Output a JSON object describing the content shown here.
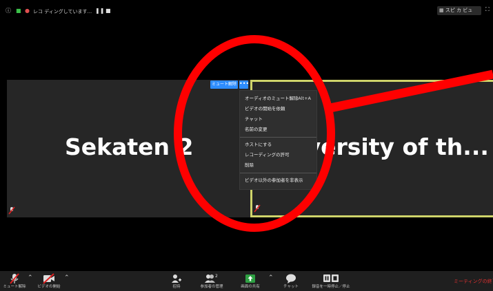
{
  "app": {
    "recording_label": "レコ ディングしています...",
    "view_label": "スピ カ ビュ"
  },
  "tiles": [
    {
      "name": "Sekaten 2"
    },
    {
      "name": "University of th..."
    }
  ],
  "hover_buttons": {
    "unmute": "ミュート解除",
    "more": "•••"
  },
  "context_menu": {
    "items": [
      {
        "label": "オーディオのミュート解除",
        "shortcut": "Alt+A"
      },
      {
        "label": "ビデオの開始を依頼"
      },
      {
        "label": "チャット"
      },
      {
        "label": "名前の変更"
      },
      {
        "label": "ホストにする"
      },
      {
        "label": "レコーディングの許可"
      },
      {
        "label": "削除"
      },
      {
        "label": "ビデオ以外の参加者を非表示"
      }
    ]
  },
  "toolbar": {
    "unmute": "ミュート解除",
    "video_start": "ビデオの開始",
    "invite": "招待",
    "participants": "参加者の管理",
    "participant_count": "2",
    "share": "画面の共有",
    "chat": "チャット",
    "recording": "録音を一時停止／停止",
    "end": "ミーティングの終了"
  },
  "colors": {
    "highlight_border": "#cfd46a",
    "accent_blue": "#2d8cff",
    "annotation_red": "#ff0000",
    "share_green": "#2ea043"
  }
}
